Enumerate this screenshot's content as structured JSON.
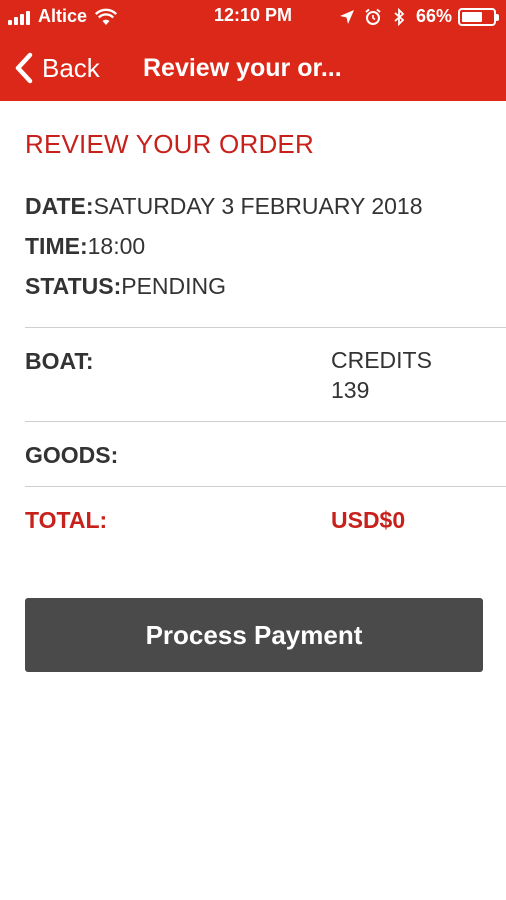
{
  "status_bar": {
    "carrier": "Altice",
    "time": "12:10 PM",
    "battery_percent": "66%",
    "battery_level": 0.66,
    "icons": [
      "signal-icon",
      "wifi-icon",
      "location-arrow-icon",
      "alarm-icon",
      "bluetooth-icon",
      "battery-icon"
    ]
  },
  "nav": {
    "back_label": "Back",
    "title": "Review your or..."
  },
  "order": {
    "heading": "REVIEW YOUR ORDER",
    "date_label": "DATE:",
    "date_value": "SATURDAY 3 FEBRUARY 2018",
    "time_label": "TIME:",
    "time_value": "18:00",
    "status_label": "STATUS:",
    "status_value": "PENDING"
  },
  "items": {
    "boat_label": "BOAT:",
    "boat_value_line1": "CREDITS",
    "boat_value_line2": "139",
    "goods_label": "GOODS:",
    "total_label": "TOTAL:",
    "total_value": "USD$0"
  },
  "actions": {
    "process_payment_label": "Process Payment"
  },
  "colors": {
    "header_bg": "#db2818",
    "accent_red": "#c8211b",
    "button_bg": "#4a4a4a"
  }
}
